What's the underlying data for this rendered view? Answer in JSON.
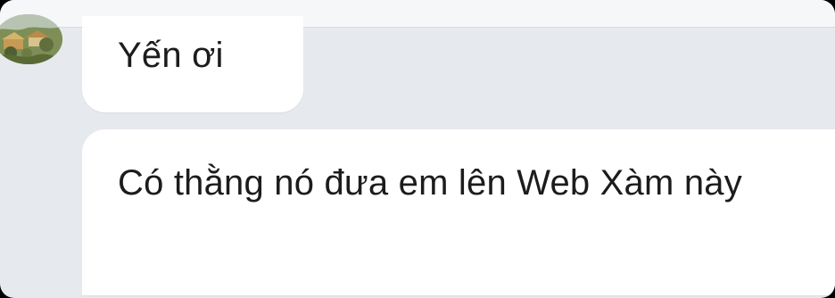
{
  "conversation": {
    "messages": [
      {
        "text": "Yến ơi"
      },
      {
        "text": "Có thằng nó đưa em lên Web Xàm này"
      }
    ]
  },
  "icons": {
    "avatar": "avatar-image"
  },
  "colors": {
    "background": "#e6e9ee",
    "bubble": "#ffffff",
    "text": "#1c1c1c"
  }
}
